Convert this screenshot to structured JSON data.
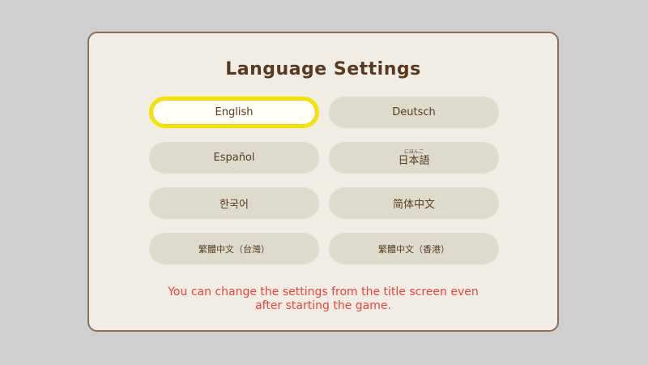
{
  "dialog": {
    "title": "Language Settings",
    "note_line1": "You can change the settings from the title screen even",
    "note_line2": "after starting the game."
  },
  "languages": [
    {
      "label": "English",
      "selected": true
    },
    {
      "label": "Deutsch",
      "selected": false
    },
    {
      "label": "Español",
      "selected": false
    },
    {
      "label": "日本語",
      "ruby": "にほんご",
      "selected": false
    },
    {
      "label": "한국어",
      "selected": false
    },
    {
      "label": "简体中文",
      "selected": false
    },
    {
      "label": "繁體中文（台灣）",
      "selected": false
    },
    {
      "label": "繁體中文（香港）",
      "selected": false
    }
  ],
  "colors": {
    "title": "#5a3a1e",
    "note": "#e6453a",
    "selected_outline": "#f5e400",
    "button_bg": "#dedbcd",
    "panel_bg": "#f1ede4"
  }
}
